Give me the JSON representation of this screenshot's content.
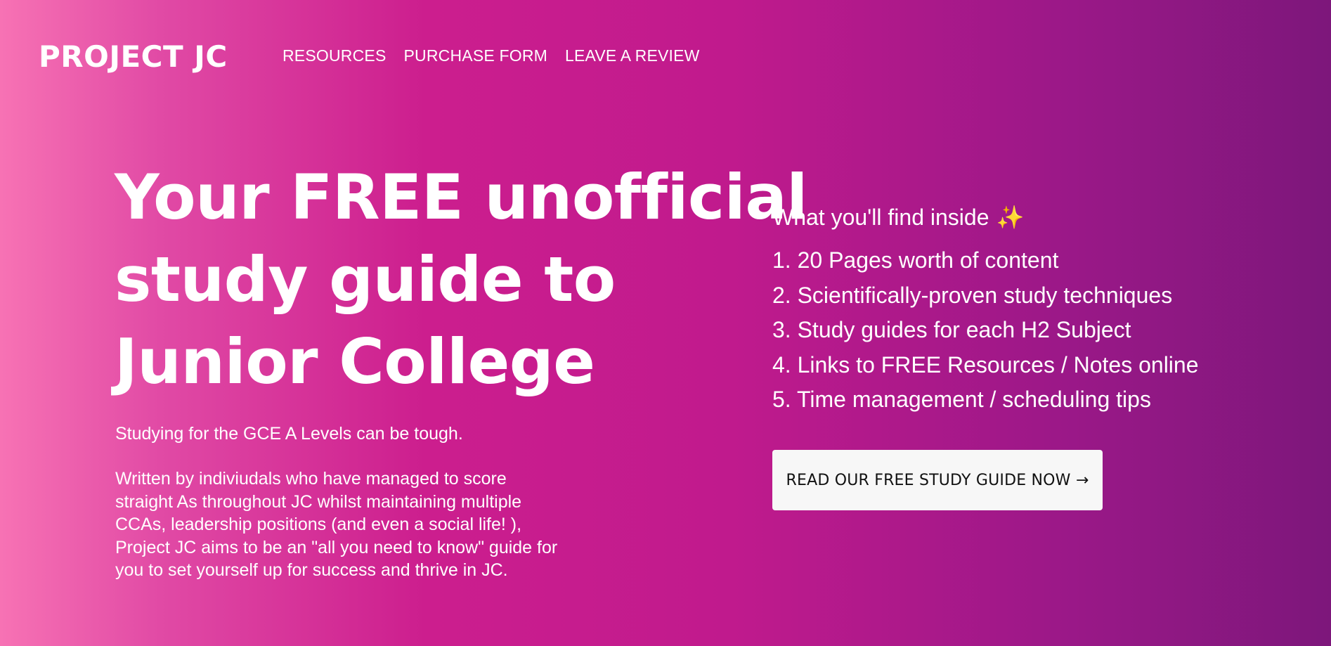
{
  "header": {
    "logo": "PROJECT JC",
    "nav": [
      {
        "label": "RESOURCES"
      },
      {
        "label": "PURCHASE FORM"
      },
      {
        "label": "LEAVE A REVIEW"
      }
    ]
  },
  "hero": {
    "title_lines": [
      "Your FREE unofficial",
      "study guide to",
      "Junior College"
    ],
    "intro": "Studying for the GCE A Levels can be tough.",
    "paragraph_lines": [
      "Written by indiviudals who have managed to score",
      "straight As throughout JC whilst maintaining multiple",
      "CCAs, leadership positions (and even a social life! ),",
      "Project JC aims to be an \"all you need to know\" guide for",
      "you to set yourself up for success and thrive in JC."
    ]
  },
  "features": {
    "title": "What you'll find inside",
    "icon": "sparkles-icon",
    "icon_glyph": "✨",
    "items": [
      "1. 20 Pages worth of content",
      "2. Scientifically-proven study techniques",
      "3. Study guides for each H2 Subject",
      "4. Links to FREE Resources / Notes online",
      "5. Time management / scheduling tips"
    ]
  },
  "cta": {
    "label": "READ OUR FREE STUDY GUIDE NOW →"
  },
  "colors": {
    "gradient_start": "#f772b4",
    "gradient_mid": "#c01a8d",
    "gradient_end": "#7d177b",
    "button_bg": "#f7f7f7",
    "text": "#ffffff"
  }
}
